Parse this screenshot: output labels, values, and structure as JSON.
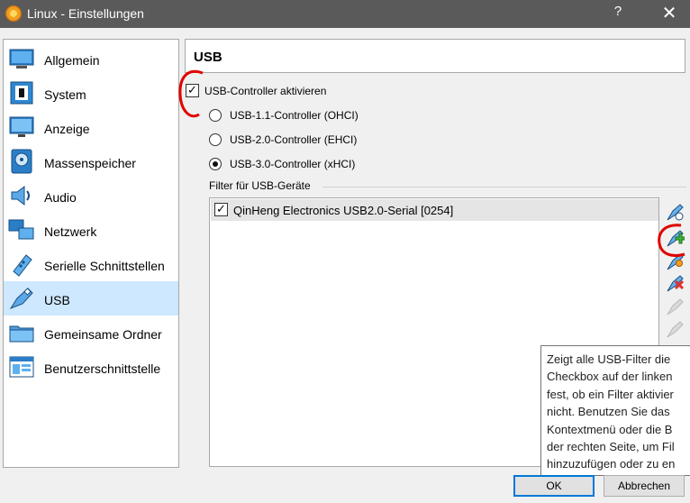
{
  "window": {
    "title": "Linux - Einstellungen",
    "help_label": "?",
    "close_label": "✕"
  },
  "sidebar": {
    "items": [
      {
        "label": "Allgemein",
        "icon": "general-icon",
        "selected": false
      },
      {
        "label": "System",
        "icon": "system-icon",
        "selected": false
      },
      {
        "label": "Anzeige",
        "icon": "display-icon",
        "selected": false
      },
      {
        "label": "Massenspeicher",
        "icon": "storage-icon",
        "selected": false
      },
      {
        "label": "Audio",
        "icon": "audio-icon",
        "selected": false
      },
      {
        "label": "Netzwerk",
        "icon": "network-icon",
        "selected": false
      },
      {
        "label": "Serielle Schnittstellen",
        "icon": "serial-ports-icon",
        "selected": false
      },
      {
        "label": "USB",
        "icon": "usb-icon",
        "selected": true
      },
      {
        "label": "Gemeinsame Ordner",
        "icon": "shared-folders-icon",
        "selected": false
      },
      {
        "label": "Benutzerschnittstelle",
        "icon": "user-interface-icon",
        "selected": false
      }
    ]
  },
  "page": {
    "title": "USB"
  },
  "usb": {
    "enable_label": "USB-Controller aktivieren",
    "enable_checked": true,
    "controllers": [
      {
        "label": "USB-1.1-Controller (OHCI)",
        "checked": false
      },
      {
        "label": "USB-2.0-Controller (EHCI)",
        "checked": false
      },
      {
        "label": "USB-3.0-Controller (xHCI)",
        "checked": true
      }
    ],
    "filters_title": "Filter für USB-Geräte",
    "filters": [
      {
        "label": "QinHeng Electronics USB2.0-Serial [0254]",
        "checked": true
      }
    ],
    "tools": [
      {
        "name": "add-empty-filter-icon",
        "enabled": true
      },
      {
        "name": "add-device-filter-icon",
        "enabled": true
      },
      {
        "name": "edit-filter-icon",
        "enabled": true
      },
      {
        "name": "remove-filter-icon",
        "enabled": true
      },
      {
        "name": "move-filter-up-icon",
        "enabled": false
      },
      {
        "name": "move-filter-down-icon",
        "enabled": false
      }
    ]
  },
  "tooltip": {
    "text": "Zeigt alle USB-Filter die\nCheckbox auf der linken\nfest, ob ein Filter aktivier\nnicht. Benutzen Sie das\nKontextmenü oder die B\nder rechten Seite, um Fil\nhinzuzufügen oder zu en"
  },
  "buttons": {
    "ok_label": "OK",
    "cancel_label": "Abbrechen"
  },
  "colors": {
    "titlebar": "#5a5a5a",
    "selection": "#cde8ff",
    "annotation": "#e00000",
    "default_button_border": "#0078d7"
  }
}
